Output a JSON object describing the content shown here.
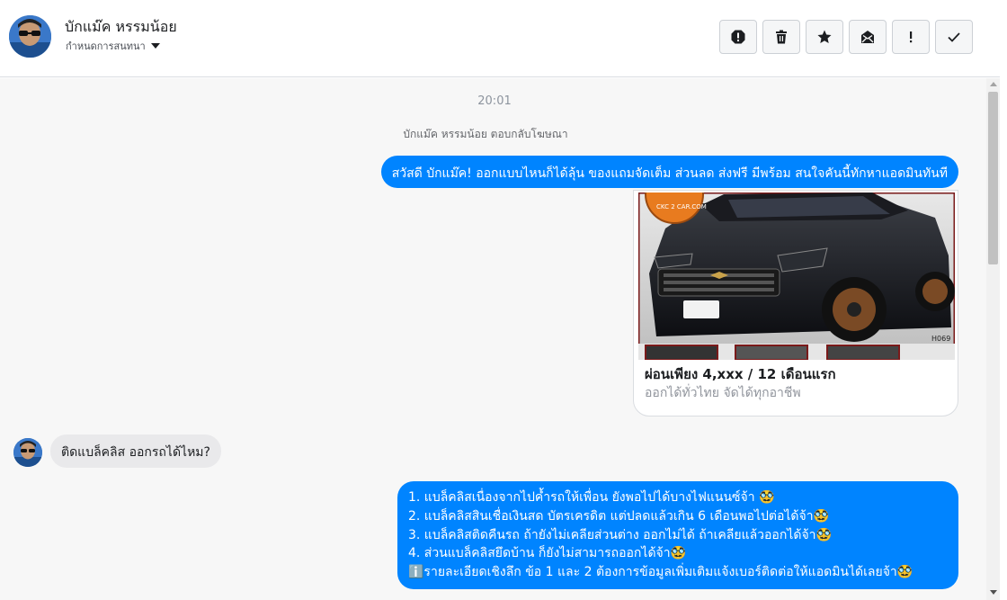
{
  "header": {
    "name": "บักแม๊ค หรรมน้อย",
    "status_label": "กำหนดการสนทนา",
    "actions": [
      {
        "name": "spam-icon"
      },
      {
        "name": "trash-icon"
      },
      {
        "name": "star-icon"
      },
      {
        "name": "mark-unread-icon"
      },
      {
        "name": "important-icon"
      },
      {
        "name": "done-check-icon"
      }
    ]
  },
  "conversation": {
    "timestamp": "20:01",
    "system_note": "บักแม๊ค หรรมน้อย ตอบกลับโฆษณา",
    "messages": [
      {
        "from": "page",
        "text": "สวัสดี บักแม๊ค! ออกแบบไหนก็ได้ลุ้น ของแถมจัดเต็ม ส่วนลด ส่งฟรี มีพร้อม สนใจคันนี้ทักหาแอดมินทันที"
      },
      {
        "from": "page",
        "type": "ad_card",
        "title": "ผ่อนเพียง 4,xxx / 12 เดือนแรก",
        "subtitle": "ออกได้ทั่วไทย จัดได้ทุกอาชีพ",
        "image_badge": "CKC 2 CAR.COM",
        "image_code": "H069"
      },
      {
        "from": "user",
        "text": "ติดแบล็คลิส ออกรถได้ไหม?"
      },
      {
        "from": "page",
        "lines": [
          "1. แบล็คลิสเนื่องจากไปค้ำรถให้เพื่อน ยังพอไปได้บางไฟแนนซ์จ้า 🥸",
          "2. แบล็คลิสสินเชื่อเงินสด บัตรเครดิต แต่ปลดแล้วเกิน 6 เดือนพอไปต่อได้จ้า🥸",
          "3. แบล็คลิสติดคืนรถ ถ้ายังไม่เคลียส่วนต่าง ออกไม่ได้ ถ้าเคลียแล้วออกได้จ้า🥸",
          "4. ส่วนแบล็คลิสยึดบ้าน ก็ยังไม่สามารถออกได้จ้า🥸",
          "ℹ️รายละเอียดเชิงลึก ข้อ 1 และ 2 ต้องการข้อมูลเพิ่มเติมแจ้งเบอร์ติดต่อให้แอดมินได้เลยจ้า🥸"
        ]
      }
    ]
  },
  "colors": {
    "outgoing_bubble": "#0084ff",
    "incoming_bubble": "#e9e9eb",
    "background": "#f7f7f7"
  }
}
